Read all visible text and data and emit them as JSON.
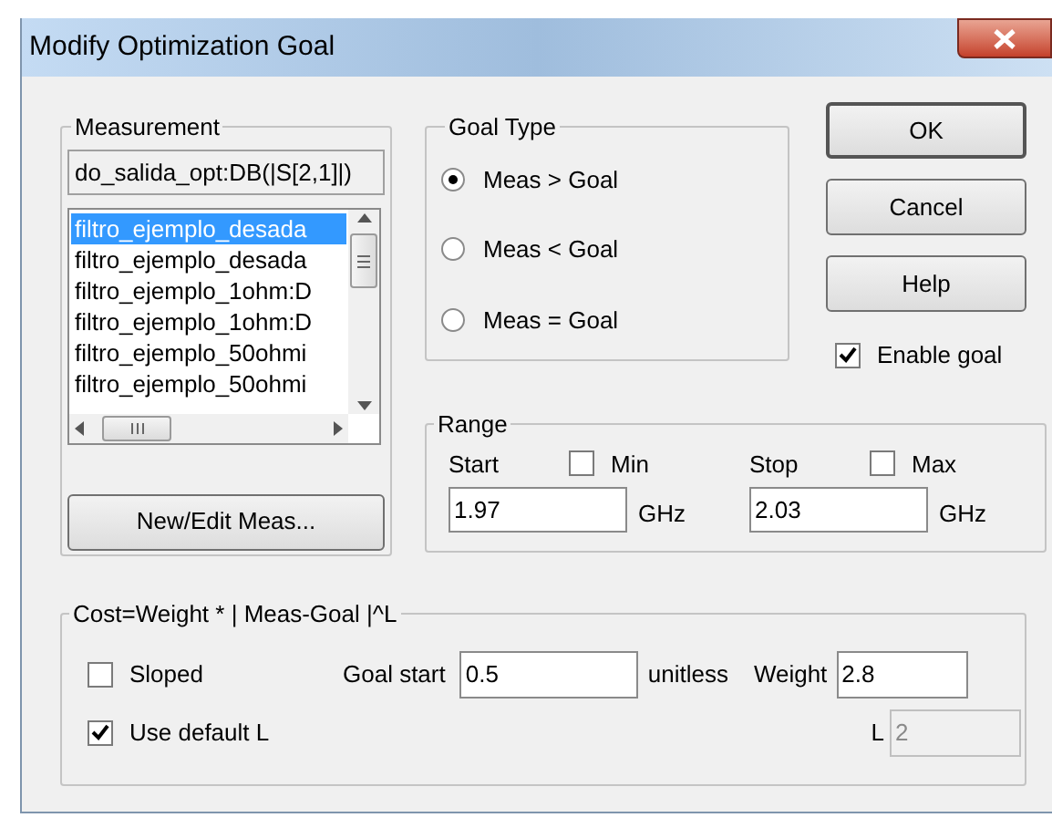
{
  "window": {
    "title": "Modify Optimization Goal"
  },
  "measurement": {
    "label": "Measurement",
    "current": "do_salida_opt:DB(|S[2,1]|)",
    "button": "New/Edit Meas...",
    "items": [
      {
        "text": "filtro_ejemplo_desada",
        "selected": true
      },
      {
        "text": "filtro_ejemplo_desada",
        "selected": false
      },
      {
        "text": "filtro_ejemplo_1ohm:D",
        "selected": false
      },
      {
        "text": "filtro_ejemplo_1ohm:D",
        "selected": false
      },
      {
        "text": "filtro_ejemplo_50ohmi",
        "selected": false
      },
      {
        "text": "filtro_ejemplo_50ohmi",
        "selected": false
      }
    ]
  },
  "goal_type": {
    "label": "Goal Type",
    "options": [
      {
        "label": "Meas > Goal",
        "selected": true
      },
      {
        "label": "Meas < Goal",
        "selected": false
      },
      {
        "label": "Meas = Goal",
        "selected": false
      }
    ]
  },
  "buttons": [
    {
      "label": "OK",
      "default": true
    },
    {
      "label": "Cancel",
      "default": false
    },
    {
      "label": "Help",
      "default": false
    }
  ],
  "enable_goal": {
    "label": "Enable goal",
    "checked": true
  },
  "range": {
    "label": "Range",
    "start": {
      "label": "Start",
      "value": "1.97",
      "unit": "GHz"
    },
    "min": {
      "label": "Min",
      "checked": false
    },
    "stop": {
      "label": "Stop",
      "value": "2.03",
      "unit": "GHz"
    },
    "max": {
      "label": "Max",
      "checked": false
    }
  },
  "cost": {
    "label": "Cost=Weight * | Meas-Goal |^L",
    "sloped": {
      "label": "Sloped",
      "checked": false
    },
    "use_default_l": {
      "label": "Use default L",
      "checked": true
    },
    "goal_start": {
      "label": "Goal start",
      "value": "0.5",
      "unit": "unitless"
    },
    "weight": {
      "label": "Weight",
      "value": "2.8"
    },
    "l": {
      "label": "L",
      "value": "2",
      "disabled": true
    }
  }
}
